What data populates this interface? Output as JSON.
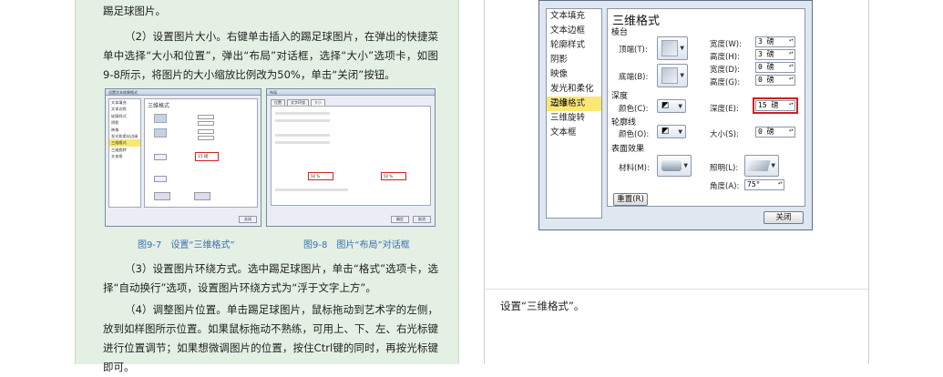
{
  "left": {
    "top_line": "踢足球图片。",
    "para2": "（2）设置图片大小。右键单击插入的踢足球图片，在弹出的快捷菜单中选择“大小和位置”，弹出“布局”对话框，选择“大小”选项卡，如图9-8所示，将图片的大小缩放比例改为50%，单击“关闭”按钮。",
    "fig7_caption": "图9-7　设置“三维格式”",
    "fig8_caption": "图9-8　图片“布局”对话框",
    "para3": "（3）设置图片环绕方式。选中踢足球图片，单击“格式”选项卡，选择“自动换行”选项，设置图片环绕方式为“浮于文字上方”。",
    "para4": "（4）调整图片位置。单击踢足球图片，鼠标拖动到艺术字的左侧，放到如样图所示位置。如果鼠标拖动不熟练，可用上、下、左、右光标键进行位置调节；如果想微调图片的位置，按住Ctrl键的同时，再按光标键即可。",
    "mini1": {
      "title": "设置文本效果格式",
      "list": [
        "文本填充",
        "文本边框",
        "轮廓样式",
        "阴影",
        "映像",
        "发光和柔化边缘",
        "三维格式",
        "三维旋转",
        "文本框"
      ],
      "heading": "三维格式",
      "depth_value": "15 磅",
      "close": "关闭"
    },
    "mini2": {
      "title": "布局",
      "tabs": [
        "位置",
        "文字环绕",
        "大小"
      ],
      "ok": "确定",
      "cancel": "取消",
      "scale_h": "50 %",
      "scale_w": "50 %"
    }
  },
  "dialog": {
    "list": [
      "文本填充",
      "文本边框",
      "轮廓样式",
      "阴影",
      "映像",
      "发光和柔化边缘",
      "三维格式",
      "三维旋转",
      "文本框"
    ],
    "selected_index": 6,
    "heading": "三维格式",
    "bevel_section": "棱台",
    "top_label": "顶端(T):",
    "bottom_label": "底端(B):",
    "width_label": "宽度(W):",
    "height_label": "高度(H):",
    "width2_label": "宽度(D):",
    "height2_label": "高度(G):",
    "top_width": "3 磅",
    "top_height": "3 磅",
    "bottom_width": "0 磅",
    "bottom_height": "0 磅",
    "depth_section": "深度",
    "color_label": "颜色(C):",
    "depth_label": "深度(E):",
    "depth_value": "15 磅",
    "contour_section": "轮廓线",
    "contour_color_label": "颜色(O):",
    "size_label": "大小(S):",
    "size_value": "0 磅",
    "surface_section": "表面效果",
    "material_label": "材料(M):",
    "lighting_label": "照明(L):",
    "angle_label": "角度(A):",
    "angle_value": "75°",
    "reset": "重置(R)",
    "close": "关闭"
  },
  "right": {
    "caption_text": "设置“三维格式”。"
  }
}
